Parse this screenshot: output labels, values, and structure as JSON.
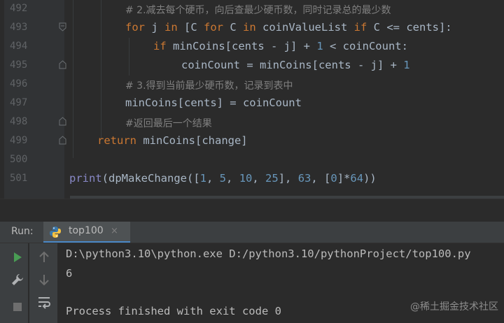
{
  "editor": {
    "lines": [
      {
        "num": "492",
        "comment": "# 2.减去每个硬币，向后查最少硬币数，同时记录总的最少数"
      },
      {
        "num": "493"
      },
      {
        "num": "494"
      },
      {
        "num": "495"
      },
      {
        "num": "496",
        "comment": "# 3.得到当前最少硬币数，记录到表中"
      },
      {
        "num": "497"
      },
      {
        "num": "498",
        "comment": "#返回最后一个结果"
      },
      {
        "num": "499"
      },
      {
        "num": "500"
      },
      {
        "num": "501"
      }
    ],
    "tokens": {
      "l493_for1": "for",
      "l493_j": " j ",
      "l493_in1": "in",
      "l493_mid": " [C ",
      "l493_for2": "for",
      "l493_c": " C ",
      "l493_in2": "in",
      "l493_list": " coinValueList ",
      "l493_if": "if",
      "l493_end": " C <= cents]:",
      "l494_if": "if",
      "l494_a": " minCoins[cents - j] + ",
      "l494_one": "1",
      "l494_b": " < coinCount:",
      "l495_a": "coinCount = minCoins[cents - j] + ",
      "l495_one": "1",
      "l497_text": "minCoins[cents] = coinCount",
      "l499_return": "return",
      "l499_rest": " minCoins[change]",
      "l501_print": "print",
      "l501_a": "(dpMakeChange([",
      "l501_n1": "1",
      "l501_c1": ", ",
      "l501_n5": "5",
      "l501_c2": ", ",
      "l501_n10": "10",
      "l501_c3": ", ",
      "l501_n25": "25",
      "l501_b": "], ",
      "l501_n63": "63",
      "l501_c4": ", [",
      "l501_n0": "0",
      "l501_c5": "]*",
      "l501_n64": "64",
      "l501_end": "))"
    }
  },
  "run_panel": {
    "label": "Run:",
    "tab": {
      "label": "top100",
      "close": "×",
      "icon": "python-icon"
    },
    "tools_left": [
      "run-icon",
      "wrench-icon",
      "stop-icon"
    ],
    "tools_right": [
      "up-arrow-icon",
      "down-arrow-icon",
      "soft-wrap-icon"
    ]
  },
  "console": {
    "command": "D:\\python3.10\\python.exe D:/python3.10/pythonProject/top100.py",
    "output": "6",
    "exit": "Process finished with exit code 0"
  },
  "watermark": "@稀土掘金技术社区",
  "colors": {
    "keyword": "#cc7832",
    "number": "#6897bb",
    "comment": "#808080",
    "builtin": "#8888c6",
    "text": "#a9b7c6",
    "run_green": "#499c54"
  }
}
